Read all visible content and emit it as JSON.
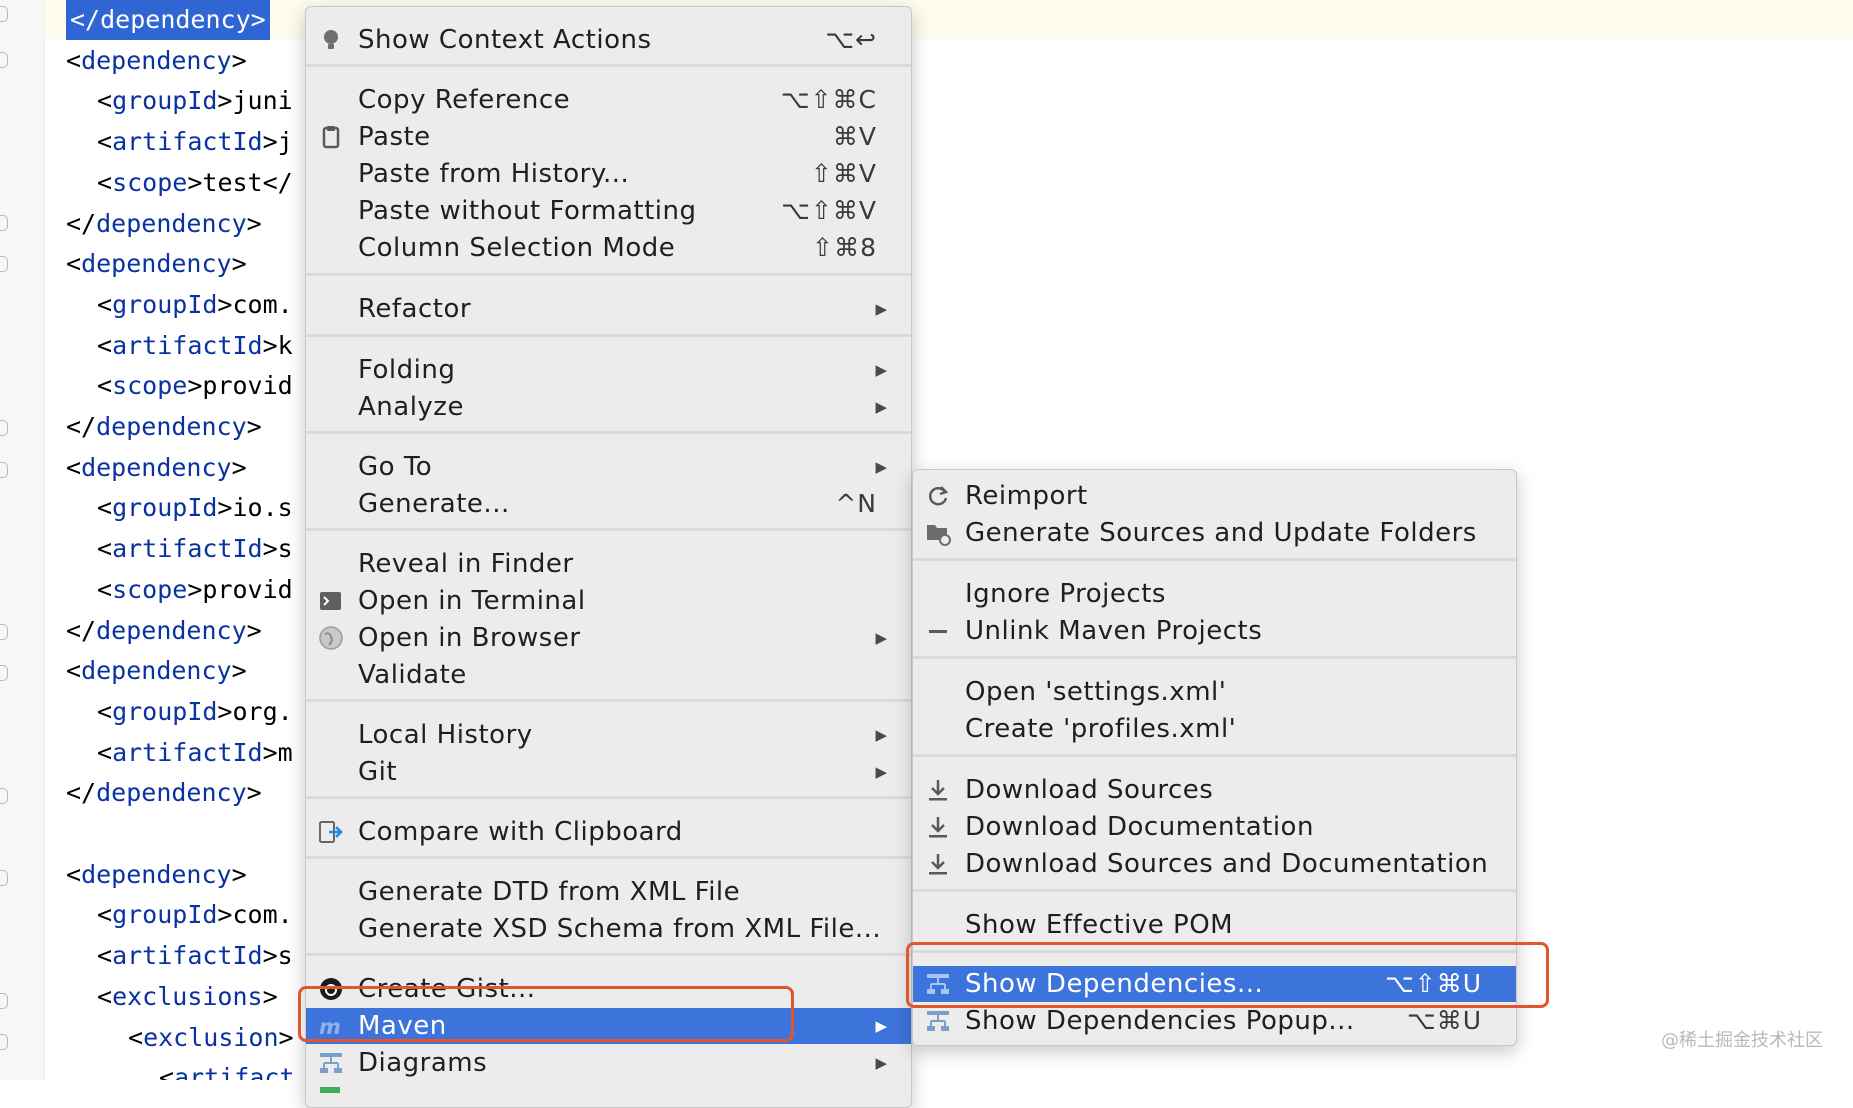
{
  "editor": {
    "lines": [
      {
        "indent": 0,
        "tag": "</dependency>",
        "text": "",
        "selected": true
      },
      {
        "indent": 0,
        "tag": "<dependency>",
        "text": ""
      },
      {
        "indent": 1,
        "tag": "<groupId>",
        "text": "juni"
      },
      {
        "indent": 1,
        "tag": "<artifactId>",
        "text": "j"
      },
      {
        "indent": 1,
        "tag": "<scope>",
        "text": "test</"
      },
      {
        "indent": 0,
        "tag": "</dependency>",
        "text": ""
      },
      {
        "indent": 0,
        "tag": "<dependency>",
        "text": ""
      },
      {
        "indent": 1,
        "tag": "<groupId>",
        "text": "com."
      },
      {
        "indent": 1,
        "tag": "<artifactId>",
        "text": "k"
      },
      {
        "indent": 1,
        "tag": "<scope>",
        "text": "provid"
      },
      {
        "indent": 0,
        "tag": "</dependency>",
        "text": ""
      },
      {
        "indent": 0,
        "tag": "<dependency>",
        "text": ""
      },
      {
        "indent": 1,
        "tag": "<groupId>",
        "text": "io.s"
      },
      {
        "indent": 1,
        "tag": "<artifactId>",
        "text": "s"
      },
      {
        "indent": 1,
        "tag": "<scope>",
        "text": "provid"
      },
      {
        "indent": 0,
        "tag": "</dependency>",
        "text": ""
      },
      {
        "indent": 0,
        "tag": "<dependency>",
        "text": ""
      },
      {
        "indent": 1,
        "tag": "<groupId>",
        "text": "org."
      },
      {
        "indent": 1,
        "tag": "<artifactId>",
        "text": "m"
      },
      {
        "indent": 0,
        "tag": "</dependency>",
        "text": ""
      },
      {
        "indent": 0,
        "tag": "",
        "text": ""
      },
      {
        "indent": 0,
        "tag": "<dependency>",
        "text": ""
      },
      {
        "indent": 1,
        "tag": "<groupId>",
        "text": "com."
      },
      {
        "indent": 1,
        "tag": "<artifactId>",
        "text": "s"
      },
      {
        "indent": 1,
        "tag": "<exclusions>",
        "text": ""
      },
      {
        "indent": 2,
        "tag": "<exclusion>",
        "text": ""
      },
      {
        "indent": 3,
        "tag": "<artifact",
        "text": ""
      }
    ]
  },
  "context_menu": {
    "show_context_actions": {
      "label": "Show Context Actions",
      "shortcut": "⌥↩"
    },
    "copy_reference": {
      "label": "Copy Reference",
      "shortcut": "⌥⇧⌘C"
    },
    "paste": {
      "label": "Paste",
      "shortcut": "⌘V"
    },
    "paste_from_history": {
      "label": "Paste from History...",
      "shortcut": "⇧⌘V"
    },
    "paste_without_formatting": {
      "label": "Paste without Formatting",
      "shortcut": "⌥⇧⌘V"
    },
    "column_selection_mode": {
      "label": "Column Selection Mode",
      "shortcut": "⇧⌘8"
    },
    "refactor": {
      "label": "Refactor"
    },
    "folding": {
      "label": "Folding"
    },
    "analyze": {
      "label": "Analyze"
    },
    "go_to": {
      "label": "Go To"
    },
    "generate": {
      "label": "Generate...",
      "shortcut": "^N"
    },
    "reveal_in_finder": {
      "label": "Reveal in Finder"
    },
    "open_in_terminal": {
      "label": "Open in Terminal"
    },
    "open_in_browser": {
      "label": "Open in Browser"
    },
    "validate": {
      "label": "Validate"
    },
    "local_history": {
      "label": "Local History"
    },
    "git": {
      "label": "Git"
    },
    "compare_with_clipboard": {
      "label": "Compare with Clipboard"
    },
    "generate_dtd": {
      "label": "Generate DTD from XML File"
    },
    "generate_xsd": {
      "label": "Generate XSD Schema from XML File..."
    },
    "create_gist": {
      "label": "Create Gist..."
    },
    "maven": {
      "label": "Maven"
    },
    "diagrams": {
      "label": "Diagrams"
    }
  },
  "maven_submenu": {
    "reimport": {
      "label": "Reimport"
    },
    "generate_sources": {
      "label": "Generate Sources and Update Folders"
    },
    "ignore_projects": {
      "label": "Ignore Projects"
    },
    "unlink_projects": {
      "label": "Unlink Maven Projects"
    },
    "open_settings": {
      "label": "Open 'settings.xml'"
    },
    "create_profiles": {
      "label": "Create 'profiles.xml'"
    },
    "download_sources": {
      "label": "Download Sources"
    },
    "download_documentation": {
      "label": "Download Documentation"
    },
    "download_both": {
      "label": "Download Sources and Documentation"
    },
    "show_effective_pom": {
      "label": "Show Effective POM"
    },
    "show_dependencies": {
      "label": "Show Dependencies...",
      "shortcut": "⌥⇧⌘U"
    },
    "show_dependencies_popup": {
      "label": "Show Dependencies Popup...",
      "shortcut": "⌥⌘U"
    }
  },
  "watermark": "@稀土掘金技术社区",
  "colors": {
    "highlight": "#3d74dc",
    "callout": "#e2552d",
    "tag": "#0a33a1"
  }
}
